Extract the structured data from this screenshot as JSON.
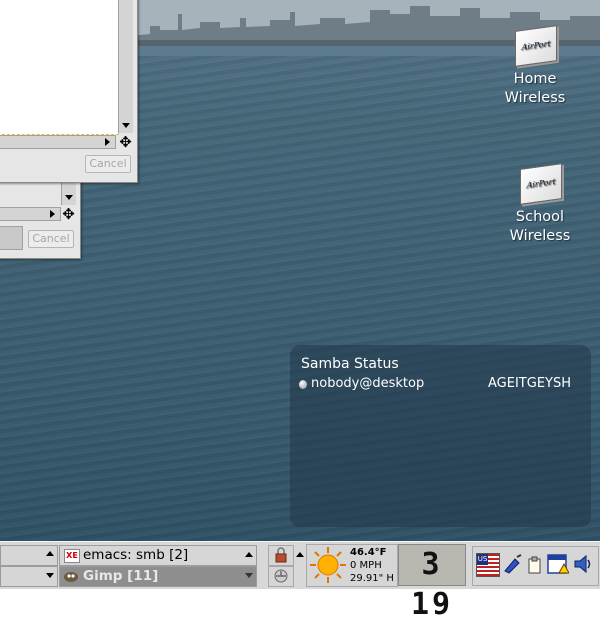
{
  "desktop": {
    "icons": [
      {
        "line1": "Home",
        "line2": "Wireless",
        "card_text": "AirPort"
      },
      {
        "line1": "School",
        "line2": "Wireless",
        "card_text": "AirPort"
      }
    ]
  },
  "windows": {
    "back": {
      "cancel_label": "Cancel"
    },
    "front": {
      "cancel_label": "Cancel"
    }
  },
  "samba": {
    "title": "Samba Status",
    "user": "nobody@desktop",
    "host": "AGEITGEYSH"
  },
  "taskbar": {
    "tasks": [
      {
        "label": "emacs: smb [2]",
        "icon": "xemacs-icon",
        "active": false
      },
      {
        "label": "Gimp [11]",
        "icon": "gimp-icon",
        "active": true
      }
    ],
    "weather": {
      "temp": "46.4°F",
      "wind": "0 MPH",
      "pressure": "29.91\" H"
    },
    "clock": {
      "time": "3 19"
    },
    "tray": {
      "flag_text": "US"
    }
  },
  "colors": {
    "panel": "#d8d8d8",
    "samba_panel": "#23374b",
    "active_task": "#8e8e8e"
  }
}
